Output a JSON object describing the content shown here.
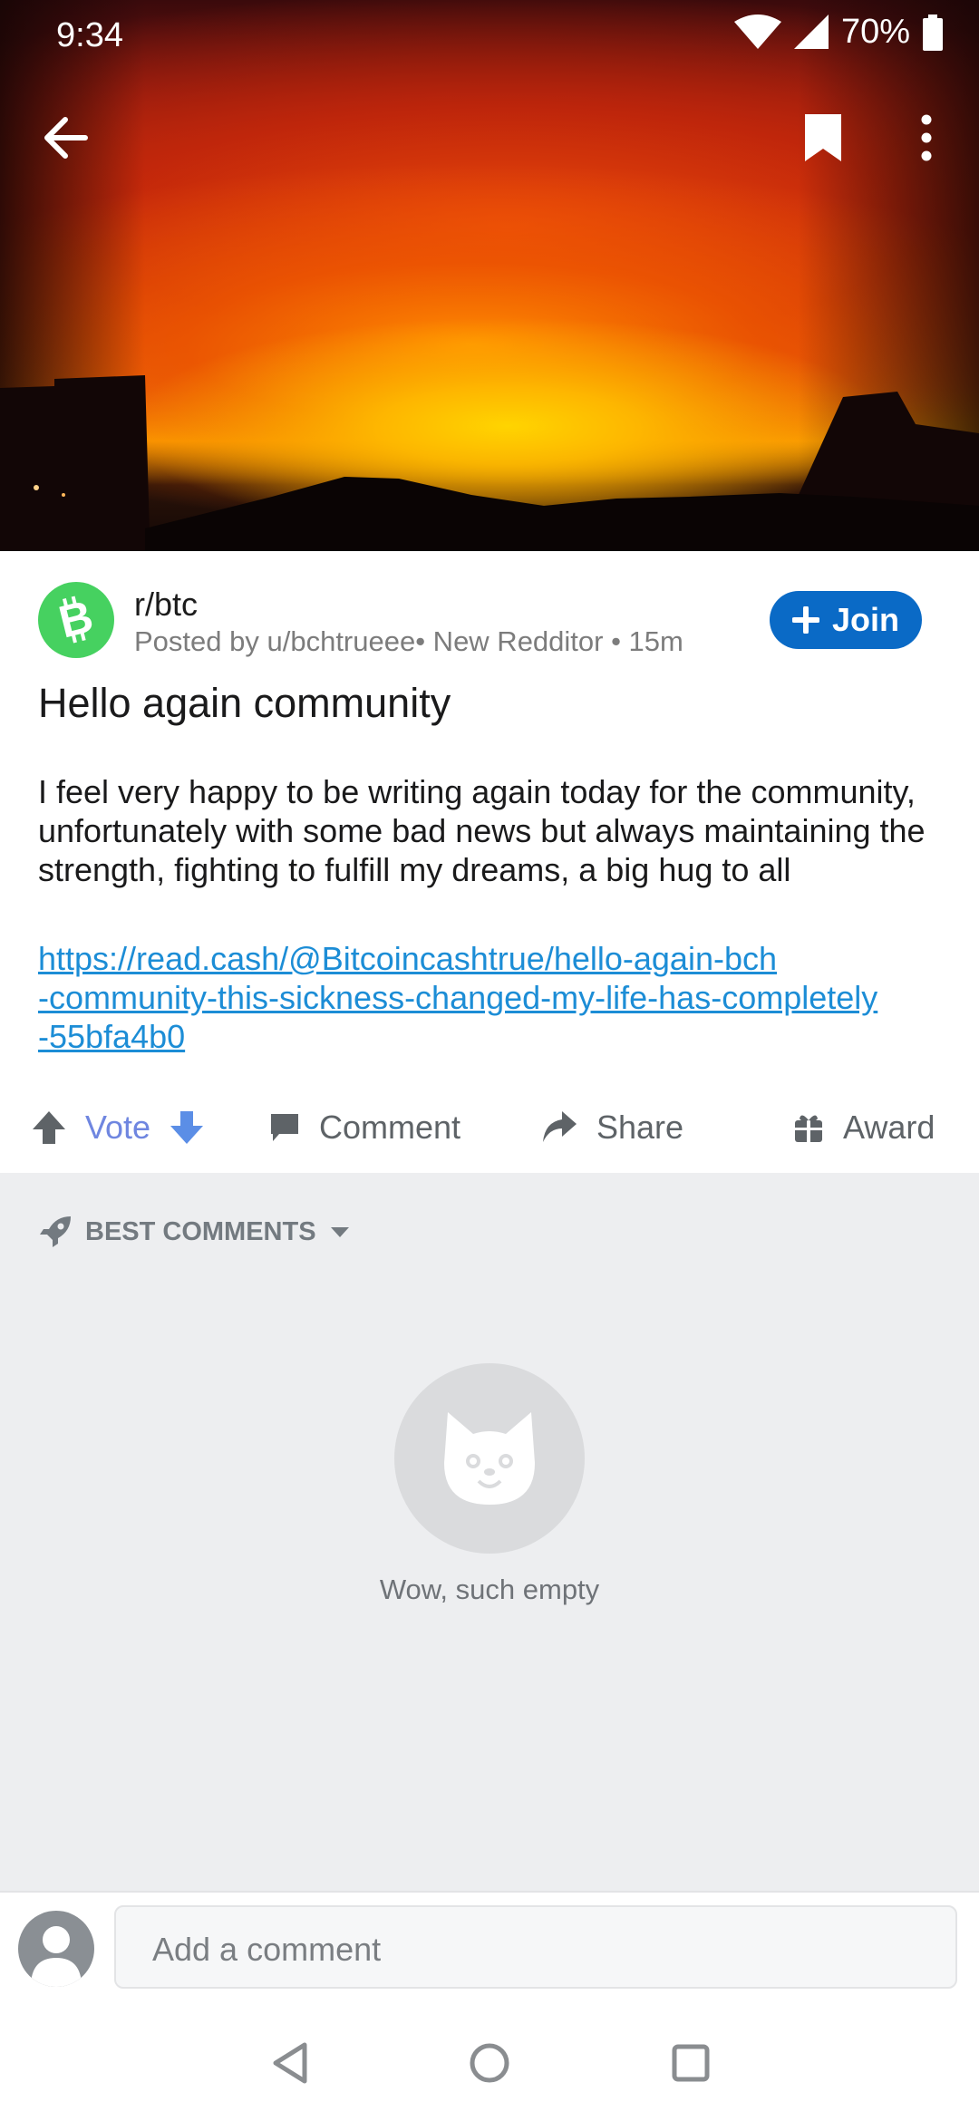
{
  "status_bar": {
    "time": "9:34",
    "battery": "70%"
  },
  "post": {
    "subreddit": "r/btc",
    "meta": "Posted by u/bchtrueee• New Redditor • 15m",
    "join_label": "Join",
    "title": "Hello again community",
    "body": "I feel very happy to be writing again today for the community, unfortunately with some bad news but always maintaining the strength, fighting to fulfill my dreams, a big hug to all",
    "link_lines": [
      "https://read.cash/@Bitcoincashtrue/hello-again-bch",
      "-community-this-sickness-changed-my-life-has-completely",
      "-55bfa4b0"
    ]
  },
  "actions": {
    "vote": "Vote",
    "comment": "Comment",
    "share": "Share",
    "award": "Award"
  },
  "comments": {
    "sort_label": "BEST COMMENTS",
    "empty_text": "Wow, such empty"
  },
  "comment_bar": {
    "placeholder": "Add a comment"
  },
  "colors": {
    "join_button": "#0a6ac6",
    "subreddit_avatar": "#46d160",
    "link": "#1c8dd6",
    "vote_accent": "#6f86e0",
    "comments_bg": "#edeef0"
  },
  "icons": {
    "top_bar": [
      "back-arrow-icon",
      "bookmark-icon",
      "more-vert-icon"
    ],
    "actions": [
      "upvote-icon",
      "downvote-icon",
      "comment-icon",
      "share-icon",
      "award-icon"
    ],
    "sort": [
      "rocket-icon",
      "caret-down-icon"
    ],
    "empty": [
      "cat-face-icon"
    ],
    "nav": [
      "nav-back-icon",
      "nav-home-icon",
      "nav-recents-icon"
    ]
  }
}
